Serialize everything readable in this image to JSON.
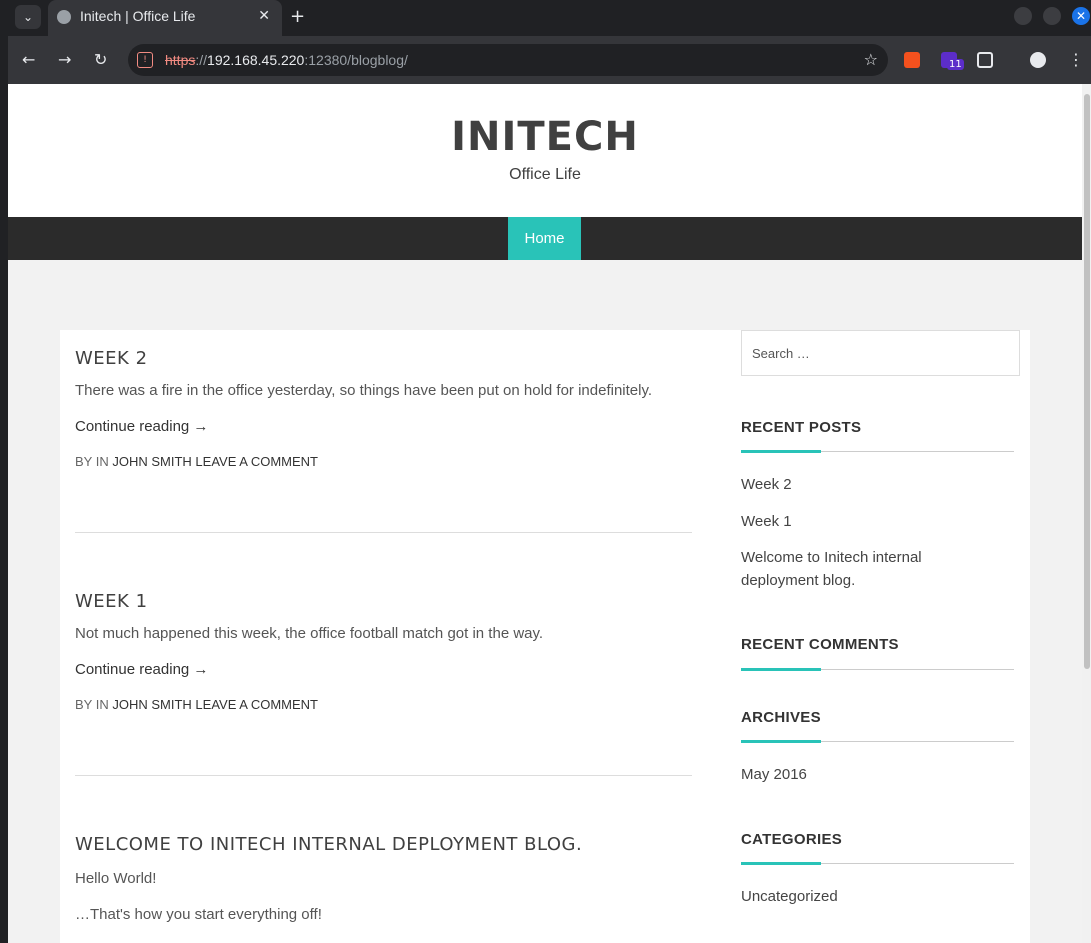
{
  "browser": {
    "tab_title": "Initech | Office Life",
    "tab_close": "✕",
    "new_tab": "+",
    "url_scheme": "https",
    "url_sep": "://",
    "url_host": "192.168.45.220",
    "url_rest": ":12380/blogblog/",
    "extension_badge": "11"
  },
  "site": {
    "title": "INITECH",
    "tagline": "Office Life",
    "nav": [
      "Home"
    ]
  },
  "posts": [
    {
      "title": "WEEK 2",
      "excerpt": "There was a fire in the office yesterday, so things have been put on hold for indefinitely.",
      "read_more": "Continue reading →",
      "meta_prefix": "BY IN",
      "author": "JOHN SMITH",
      "comment": "LEAVE A COMMENT"
    },
    {
      "title": "WEEK 1",
      "excerpt": "Not much happened this week, the office football match got in the way.",
      "read_more": "Continue reading →",
      "meta_prefix": "BY IN",
      "author": "JOHN SMITH",
      "comment": "LEAVE A COMMENT"
    },
    {
      "title": "WELCOME TO INITECH INTERNAL DEPLOYMENT BLOG.",
      "lines": [
        "Hello World!",
        "…That's how you start everything off!"
      ]
    }
  ],
  "sidebar": {
    "search_placeholder": "Search …",
    "recent_posts_title": "RECENT POSTS",
    "recent_posts": [
      "Week 2",
      "Week 1",
      "Welcome to Initech internal deployment blog."
    ],
    "recent_comments_title": "RECENT COMMENTS",
    "archives_title": "ARCHIVES",
    "archives": [
      "May 2016"
    ],
    "categories_title": "CATEGORIES",
    "categories": [
      "Uncategorized"
    ]
  },
  "colors": {
    "accent": "#29c3b8",
    "navbar": "#2b2b2b"
  }
}
